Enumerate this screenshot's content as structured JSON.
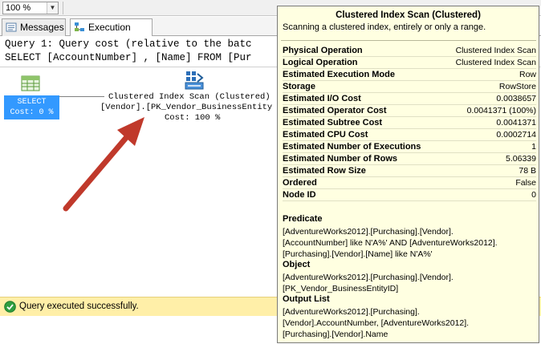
{
  "zoom": {
    "value": "100 %"
  },
  "tabs": [
    {
      "label": "Messages",
      "icon": "messages-icon"
    },
    {
      "label": "Execution plan",
      "icon": "execution-plan-icon",
      "active": true
    }
  ],
  "plan": {
    "query_line1": "Query 1: Query cost (relative to the batc",
    "query_line2": "SELECT [AccountNumber] , [Name] FROM [Pur",
    "select_node": {
      "label": "SELECT",
      "cost": "Cost: 0 %",
      "icon": "select-icon"
    },
    "scan_node": {
      "line1": "Clustered Index Scan (Clustered)",
      "line2": "[Vendor].[PK_Vendor_BusinessEntity",
      "line3": "Cost: 100 %",
      "icon": "clustered-index-scan-icon"
    },
    "arrow_color": "#c0392b"
  },
  "status": {
    "text": "Query executed successfully.",
    "icon": "success-check-icon",
    "bg": "#ffefa8"
  },
  "tooltip": {
    "title": "Clustered Index Scan (Clustered)",
    "description": "Scanning a clustered index, entirely or only a range.",
    "properties": [
      {
        "key": "Physical Operation",
        "value": "Clustered Index Scan"
      },
      {
        "key": "Logical Operation",
        "value": "Clustered Index Scan"
      },
      {
        "key": "Estimated Execution Mode",
        "value": "Row"
      },
      {
        "key": "Storage",
        "value": "RowStore"
      },
      {
        "key": "Estimated I/O Cost",
        "value": "0.0038657"
      },
      {
        "key": "Estimated Operator Cost",
        "value": "0.0041371 (100%)"
      },
      {
        "key": "Estimated Subtree Cost",
        "value": "0.0041371"
      },
      {
        "key": "Estimated CPU Cost",
        "value": "0.0002714"
      },
      {
        "key": "Estimated Number of Executions",
        "value": "1"
      },
      {
        "key": "Estimated Number of Rows",
        "value": "5.06339"
      },
      {
        "key": "Estimated Row Size",
        "value": "78 B"
      },
      {
        "key": "Ordered",
        "value": "False"
      },
      {
        "key": "Node ID",
        "value": "0"
      }
    ],
    "predicate": {
      "heading": "Predicate",
      "lines": [
        "[AdventureWorks2012].[Purchasing].[Vendor].",
        "[AccountNumber] like N'A%' AND [AdventureWorks2012].",
        "[Purchasing].[Vendor].[Name] like N'A%'"
      ]
    },
    "object": {
      "heading": "Object",
      "lines": [
        "[AdventureWorks2012].[Purchasing].[Vendor].",
        "[PK_Vendor_BusinessEntityID]"
      ]
    },
    "output_list": {
      "heading": "Output List",
      "lines": [
        "[AdventureWorks2012].[Purchasing].",
        "[Vendor].AccountNumber, [AdventureWorks2012].",
        "[Purchasing].[Vendor].Name"
      ]
    }
  }
}
